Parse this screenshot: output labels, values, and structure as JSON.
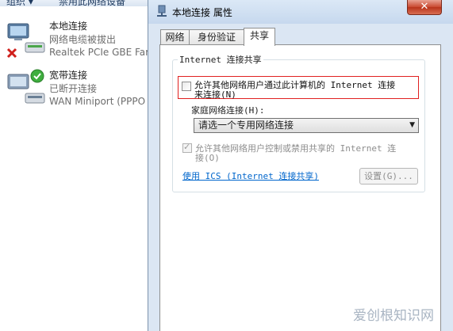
{
  "background": {
    "toolbar": {
      "organize_label": "组织 ▾",
      "disable_label": "禁用此网络设备"
    },
    "connections": [
      {
        "name": "本地连接",
        "status": "网络电缆被拔出",
        "device": "Realtek PCIe GBE Far",
        "icon": "network-adapter-disconnected-icon"
      },
      {
        "name": "宽带连接",
        "status": "已断开连接",
        "device": "WAN Miniport (PPPO",
        "icon": "broadband-connection-icon"
      }
    ]
  },
  "dialog": {
    "title": "本地连接 属性",
    "close_symbol": "✕",
    "tabs": [
      {
        "label": "网络"
      },
      {
        "label": "身份验证"
      },
      {
        "label": "共享",
        "active": true
      }
    ],
    "sharing": {
      "group_title": "Internet 连接共享",
      "allow_share_label": "允许其他网络用户通过此计算机的 Internet 连接\n来连接(N)",
      "allow_share_checked": false,
      "home_network_label": "家庭网络连接(H):",
      "home_network_select": "请选一个专用网络连接",
      "allow_control_label": "允许其他网络用户控制或禁用共享的 Internet 连\n接(O)",
      "allow_control_checked": true,
      "allow_control_disabled": true,
      "ics_link": "使用 ICS (Internet 连接共享)",
      "settings_button": "设置(G)..."
    }
  },
  "watermark": "爱创根知识网",
  "colors": {
    "highlight_border": "#e02020",
    "link": "#0066cc",
    "close_button": "#c9482f"
  }
}
